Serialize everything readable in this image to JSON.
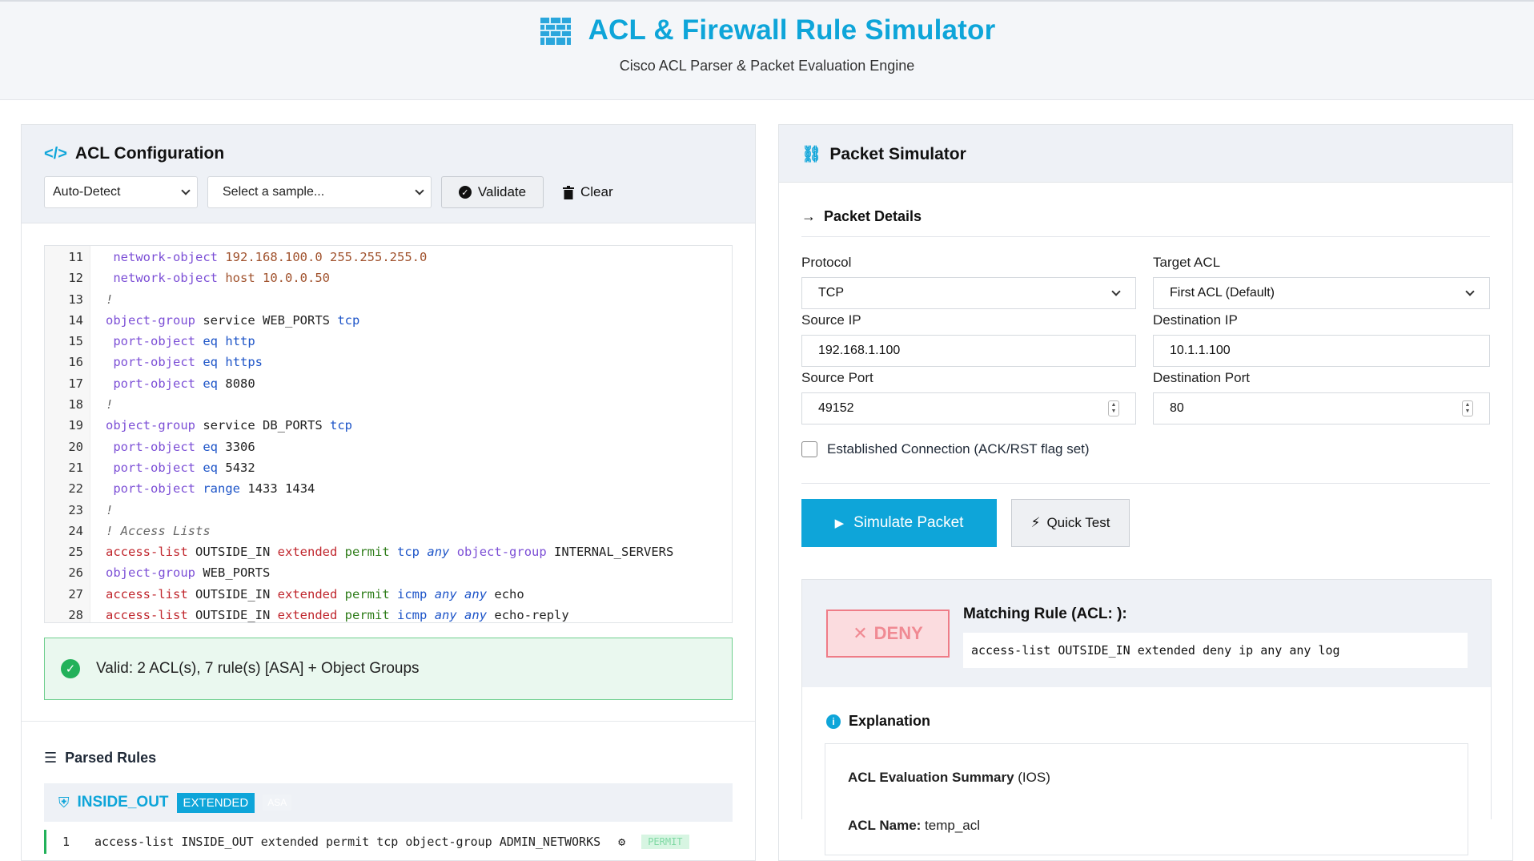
{
  "header": {
    "title": "ACL & Firewall Rule Simulator",
    "subtitle": "Cisco ACL Parser & Packet Evaluation Engine",
    "logo_icon": "brick-wall-icon"
  },
  "acl_config": {
    "title": "ACL Configuration",
    "format_select": "Auto-Detect",
    "sample_select": "Select a sample...",
    "validate_label": "Validate",
    "clear_label": "Clear",
    "code_lines": [
      {
        "n": "11",
        "text": " network-object 192.168.100.0 255.255.255.0"
      },
      {
        "n": "12",
        "text": " network-object host 10.0.0.50"
      },
      {
        "n": "13",
        "text": "!"
      },
      {
        "n": "14",
        "text": "object-group service WEB_PORTS tcp"
      },
      {
        "n": "15",
        "text": " port-object eq http"
      },
      {
        "n": "16",
        "text": " port-object eq https"
      },
      {
        "n": "17",
        "text": " port-object eq 8080"
      },
      {
        "n": "18",
        "text": "!"
      },
      {
        "n": "19",
        "text": "object-group service DB_PORTS tcp"
      },
      {
        "n": "20",
        "text": " port-object eq 3306"
      },
      {
        "n": "21",
        "text": " port-object eq 5432"
      },
      {
        "n": "22",
        "text": " port-object range 1433 1434"
      },
      {
        "n": "23",
        "text": "!"
      },
      {
        "n": "24",
        "text": "! Access Lists"
      },
      {
        "n": "25",
        "text": "access-list OUTSIDE_IN extended permit tcp any object-group INTERNAL_SERVERS"
      },
      {
        "n": "26",
        "text": "object-group WEB_PORTS"
      },
      {
        "n": "27",
        "text": "access-list OUTSIDE_IN extended permit icmp any any echo"
      },
      {
        "n": "28",
        "text": "access-list OUTSIDE_IN extended permit icmp any any echo-reply"
      }
    ],
    "validation_message": "Valid: 2 ACL(s), 7 rule(s) [ASA] + Object Groups"
  },
  "parsed_rules": {
    "title": "Parsed Rules",
    "acl_name": "INSIDE_OUT",
    "acl_type_badge": "EXTENDED",
    "platform_badge": "ASA",
    "first_rule_index": "1",
    "first_rule_text": "access-list INSIDE_OUT extended permit tcp object-group ADMIN_NETWORKS",
    "first_rule_action": "PERMIT"
  },
  "packet_sim": {
    "title": "Packet Simulator",
    "details_title": "Packet Details",
    "protocol_label": "Protocol",
    "protocol_value": "TCP",
    "target_acl_label": "Target ACL",
    "target_acl_value": "First ACL (Default)",
    "source_ip_label": "Source IP",
    "source_ip_value": "192.168.1.100",
    "dest_ip_label": "Destination IP",
    "dest_ip_value": "10.1.1.100",
    "source_port_label": "Source Port",
    "source_port_value": "49152",
    "dest_port_label": "Destination Port",
    "dest_port_value": "80",
    "established_label": "Established Connection (ACK/RST flag set)",
    "simulate_label": "Simulate Packet",
    "quick_test_label": "Quick Test"
  },
  "result": {
    "verdict": "DENY",
    "matching_label": "Matching Rule (ACL: ):",
    "matching_rule": "access-list OUTSIDE_IN extended deny ip any any log",
    "explanation_title": "Explanation",
    "summary_bold": "ACL Evaluation Summary",
    "summary_rest": " (IOS)",
    "acl_name_label": "ACL Name:",
    "acl_name_value": " temp_acl"
  },
  "colors": {
    "accent": "#0ea5d9",
    "valid_green": "#22b15a",
    "deny_red": "#ef7c87"
  }
}
